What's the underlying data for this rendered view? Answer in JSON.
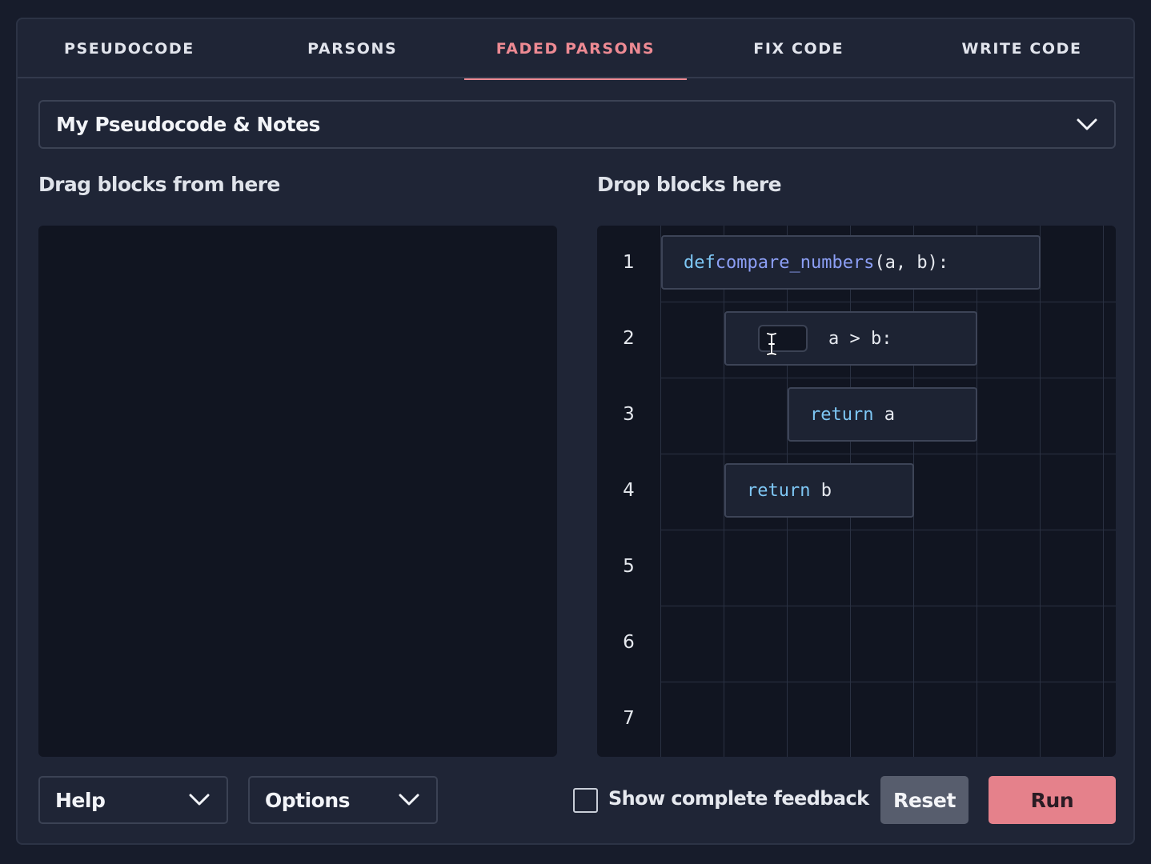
{
  "tabs": [
    {
      "label": "PSEUDOCODE",
      "active": false
    },
    {
      "label": "PARSONS",
      "active": false
    },
    {
      "label": "FADED PARSONS",
      "active": true
    },
    {
      "label": "FIX CODE",
      "active": false
    },
    {
      "label": "WRITE CODE",
      "active": false
    }
  ],
  "pseudocode_select": {
    "label": "My Pseudocode & Notes"
  },
  "source": {
    "title": "Drag blocks from here"
  },
  "target": {
    "title": "Drop blocks here",
    "line_numbers": [
      "1",
      "2",
      "3",
      "4",
      "5",
      "6",
      "7"
    ],
    "blocks": {
      "def": {
        "keyword": "def",
        "name": "compare_numbers",
        "rest": "(a, b):"
      },
      "if": {
        "blank_value": "",
        "rest": "a > b:"
      },
      "return_a": {
        "keyword": "return",
        "rest": " a"
      },
      "return_b": {
        "keyword": "return",
        "rest": " b"
      }
    }
  },
  "footer": {
    "help_label": "Help",
    "options_label": "Options",
    "feedback_label": "Show complete feedback",
    "feedback_checked": false,
    "reset_label": "Reset",
    "run_label": "Run"
  },
  "colors": {
    "accent": "#ed8a93",
    "run_button": "#e5818b",
    "reset_button": "#575d6d",
    "keyword": "#7ec7f5",
    "function_name": "#8c9ff5"
  },
  "icons": {
    "dropdown": "chevron-down-icon",
    "text_cursor": "text-cursor-icon"
  }
}
